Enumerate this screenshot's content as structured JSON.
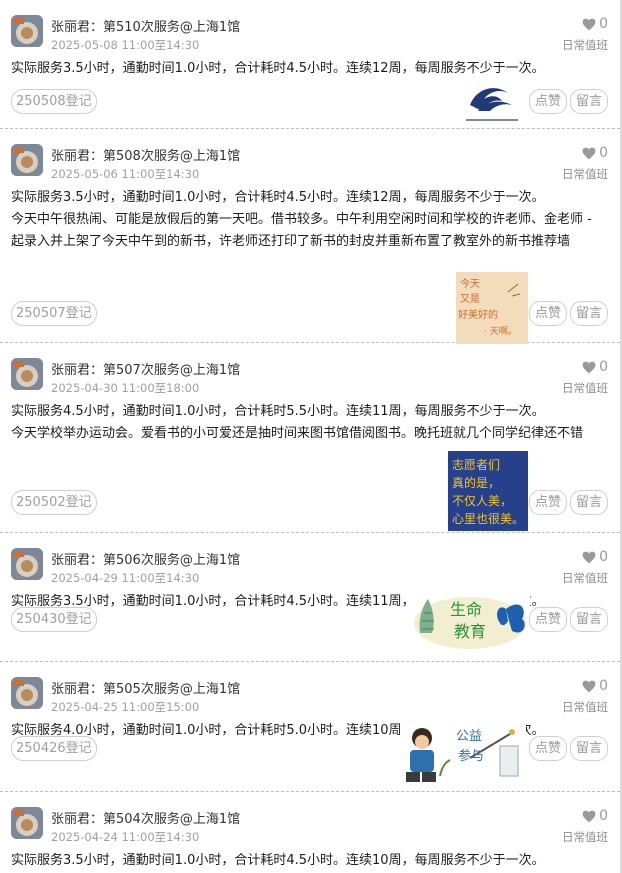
{
  "entries": [
    {
      "user": "张丽君",
      "title": "张丽君：第510次服务@上海1馆",
      "time": "2025-05-08 11:00至14:30",
      "likes": "0",
      "shift": "日常值班",
      "paragraphs": [
        "实际服务3.5小时，通勤时间1.0小时，合计耗时4.5小时。连续12周，每周服务不少于一次。"
      ],
      "register_label": "250508登记",
      "like_label": "点赞",
      "message_label": "留言",
      "picture": "logo"
    },
    {
      "user": "张丽君",
      "title": "张丽君：第508次服务@上海1馆",
      "time": "2025-05-06 11:00至14:30",
      "likes": "0",
      "shift": "日常值班",
      "paragraphs": [
        "实际服务3.5小时，通勤时间1.0小时，合计耗时4.5小时。连续12周，每周服务不少于一次。",
        "今天中午很热闹、可能是放假后的第一天吧。借书较多。中午利用空闲时间和学校的许老师、金老师 - 起录入并上架了今天中午到的新书，许老师还打印了新书的封皮并重新布置了教室外的新书推荐墙"
      ],
      "register_label": "250507登记",
      "like_label": "点赞",
      "message_label": "留言",
      "picture": "card-good-day",
      "picture_text": [
        "今天",
        "又是",
        "好美好的",
        "· 天啊。"
      ]
    },
    {
      "user": "张丽君",
      "title": "张丽君：第507次服务@上海1馆",
      "time": "2025-04-30 11:00至18:00",
      "likes": "0",
      "shift": "日常值班",
      "paragraphs": [
        "实际服务4.5小时，通勤时间1.0小时，合计耗时5.5小时。连续11周，每周服务不少于一次。",
        "今天学校举办运动会。爱看书的小可爱还是抽时间来图书馆借阅图书。晚托班就几个同学纪律还不错"
      ],
      "register_label": "250502登记",
      "like_label": "点赞",
      "message_label": "留言",
      "picture": "card-volunteer",
      "picture_text": [
        "志愿者们",
        "真的是，",
        "不仅人美，",
        "心里也很美。"
      ]
    },
    {
      "user": "张丽君",
      "title": "张丽君：第506次服务@上海1馆",
      "time": "2025-04-29 11:00至14:30",
      "likes": "0",
      "shift": "日常值班",
      "paragraphs": [
        "实际服务3.5小时，通勤时间1.0小时，合计耗时4.5小时。连续11周，每周服务不少于一次。"
      ],
      "register_label": "250430登记",
      "like_label": "点赞",
      "message_label": "留言",
      "picture": "card-life-education",
      "picture_text": [
        "生命",
        "教育"
      ]
    },
    {
      "user": "张丽君",
      "title": "张丽君：第505次服务@上海1馆",
      "time": "2025-04-25 11:00至15:00",
      "likes": "0",
      "shift": "日常值班",
      "paragraphs": [
        "实际服务4.0小时，通勤时间1.0小时，合计耗时5.0小时。连续10周，每周服务不少于一次。"
      ],
      "register_label": "250426登记",
      "like_label": "点赞",
      "message_label": "留言",
      "picture": "card-public-welfare",
      "picture_text": [
        "公益",
        "参与"
      ]
    },
    {
      "user": "张丽君",
      "title": "张丽君：第504次服务@上海1馆",
      "time": "2025-04-24 11:00至14:30",
      "likes": "0",
      "shift": "日常值班",
      "paragraphs": [
        "实际服务3.5小时，通勤时间1.0小时，合计耗时4.5小时。连续10周，每周服务不少于一次。"
      ],
      "register_label": "",
      "like_label": "",
      "message_label": "",
      "picture": "none"
    }
  ],
  "colors": {
    "heart": "#9a9a9a",
    "border": "#cfcfcf",
    "time": "#a0a0a0",
    "volunteer_card": "#27408b",
    "volunteer_text": "#f3c622"
  }
}
